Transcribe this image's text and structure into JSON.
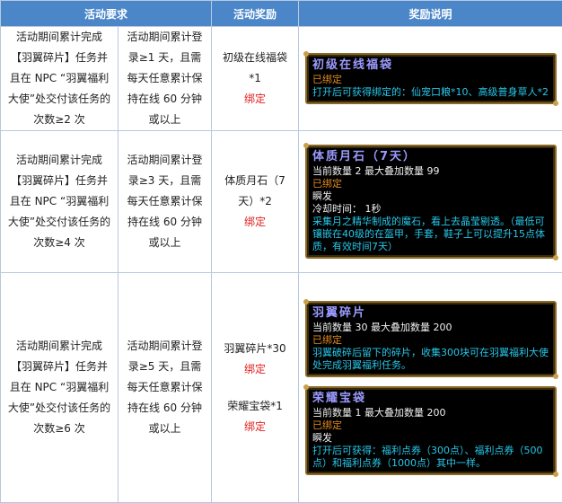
{
  "headers": [
    "活动要求",
    "活动奖励",
    "奖励说明"
  ],
  "rows": [
    {
      "task": "活动期间累计完成【羽翼碎片】任务并且在 NPC “羽翼福利大使”处交付该任务的次数≥2 次",
      "login": "活动期间累计登录≥1 天，且需每天任意累计保持在线 60 分钟或以上",
      "rewards": [
        {
          "name": "初级在线福袋*1",
          "bind": "绑定"
        }
      ],
      "tooltips": [
        {
          "title": "初级在线福袋",
          "lines": [
            {
              "color": "orange",
              "text": "已绑定"
            },
            {
              "color": "cyan",
              "text": "打开后可获得绑定的：仙宠口粮*10、高级普身草人*2"
            }
          ]
        }
      ]
    },
    {
      "task": "活动期间累计完成【羽翼碎片】任务并且在 NPC “羽翼福利大使”处交付该任务的次数≥4 次",
      "login": "活动期间累计登录≥3 天，且需每天任意累计保持在线 60 分钟或以上",
      "rewards": [
        {
          "name": "体质月石（7天）*2",
          "bind": "绑定"
        }
      ],
      "tooltips": [
        {
          "title": "体质月石（7天）",
          "lines": [
            {
              "color": "white",
              "text": "当前数量 2 最大叠加数量 99"
            },
            {
              "color": "orange",
              "text": "已绑定"
            },
            {
              "color": "white",
              "text": "瞬发"
            },
            {
              "color": "white",
              "text": "冷却时间： 1秒"
            },
            {
              "color": "cyan",
              "text": "采集月之精华制成的魔石，看上去晶莹剔透。（最低可镶嵌在40级的在盔甲，手套，鞋子上可以提升15点体质，有效时间7天）"
            }
          ]
        }
      ]
    },
    {
      "task": "活动期间累计完成【羽翼碎片】任务并且在 NPC “羽翼福利大使”处交付该任务的次数≥6 次",
      "login": "活动期间累计登录≥5 天，且需每天任意累计保持在线 60 分钟或以上",
      "rewards": [
        {
          "name": "羽翼碎片*30",
          "bind": "绑定"
        },
        {
          "name": "荣耀宝袋*1",
          "bind": "绑定"
        }
      ],
      "tooltips": [
        {
          "title": "羽翼碎片",
          "lines": [
            {
              "color": "white",
              "text": "当前数量 30 最大叠加数量 200"
            },
            {
              "color": "orange",
              "text": "已绑定"
            },
            {
              "color": "cyan",
              "text": "羽翼破碎后留下的碎片，收集300块可在羽翼福利大使处完成羽翼福利任务。"
            }
          ]
        },
        {
          "title": "荣耀宝袋",
          "lines": [
            {
              "color": "white",
              "text": "当前数量 1 最大叠加数量 200"
            },
            {
              "color": "orange",
              "text": "已绑定"
            },
            {
              "color": "white",
              "text": "瞬发"
            },
            {
              "color": "cyan",
              "text": "打开后可获得：福利点券（300点）、福利点券（500点）和福利点券（1000点）其中一样。"
            }
          ]
        }
      ]
    }
  ]
}
